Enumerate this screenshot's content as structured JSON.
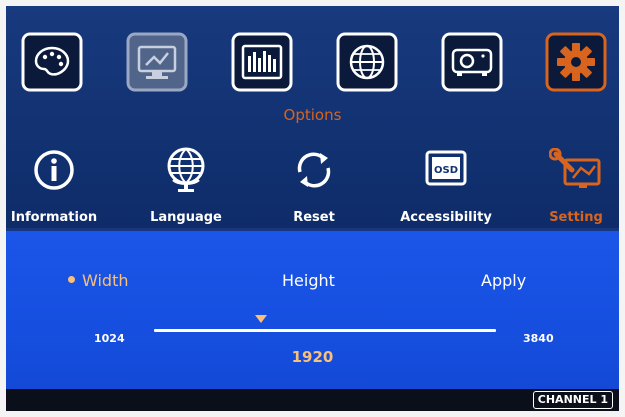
{
  "window": {
    "background": "#000000"
  },
  "main_menu": {
    "items": [
      {
        "icon": "palette-icon"
      },
      {
        "icon": "monitor-settings-icon"
      },
      {
        "icon": "equalizer-icon"
      },
      {
        "icon": "globe-icon"
      },
      {
        "icon": "projector-icon"
      },
      {
        "icon": "gear-icon",
        "selected": true
      }
    ],
    "active_color": "#d8641d"
  },
  "section": {
    "title": "Options"
  },
  "submenu": {
    "items": [
      {
        "label": "Information",
        "icon": "info-icon"
      },
      {
        "label": "Language",
        "icon": "globe-icon"
      },
      {
        "label": "Reset",
        "icon": "reset-icon"
      },
      {
        "label": "Accessibility",
        "icon": "osd-icon",
        "icon_text": "OSD"
      },
      {
        "label": "Setting",
        "icon": "wrench-icon",
        "selected": true
      }
    ]
  },
  "settings": {
    "tabs": [
      {
        "label": "Width",
        "selected": true
      },
      {
        "label": "Height"
      },
      {
        "label": "Apply"
      }
    ],
    "slider": {
      "min": "1024",
      "max": "3840",
      "value": "1920"
    }
  },
  "status": {
    "channel": "CHANNEL 1"
  }
}
